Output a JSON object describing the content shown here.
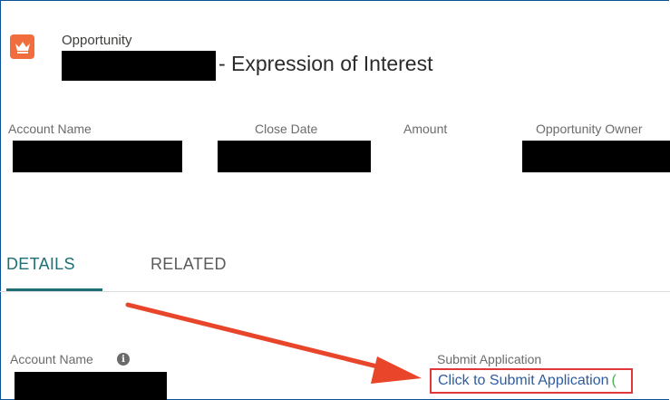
{
  "header": {
    "object_label": "Opportunity",
    "title_suffix": "- Expression of Interest",
    "icon": "crown-icon",
    "icon_color": "#f26d3d"
  },
  "highlights": {
    "fields": [
      {
        "label": "Account Name"
      },
      {
        "label": "Close Date"
      },
      {
        "label": "Amount"
      },
      {
        "label": "Opportunity Owner"
      }
    ]
  },
  "tabs": [
    {
      "label": "DETAILS",
      "active": true
    },
    {
      "label": "RELATED",
      "active": false
    }
  ],
  "details": {
    "account_name_label": "Account Name",
    "info_icon": "info-icon",
    "submit_application_label": "Submit Application",
    "submit_link_text": "Click to Submit Application",
    "submit_link_tail": "("
  },
  "annotation": {
    "arrow_color": "#e8452a",
    "highlight_box_color": "#e0373b"
  },
  "colors": {
    "tab_active": "#1f6f74",
    "frame_border": "#0b5394",
    "link": "#2e5c9e"
  }
}
